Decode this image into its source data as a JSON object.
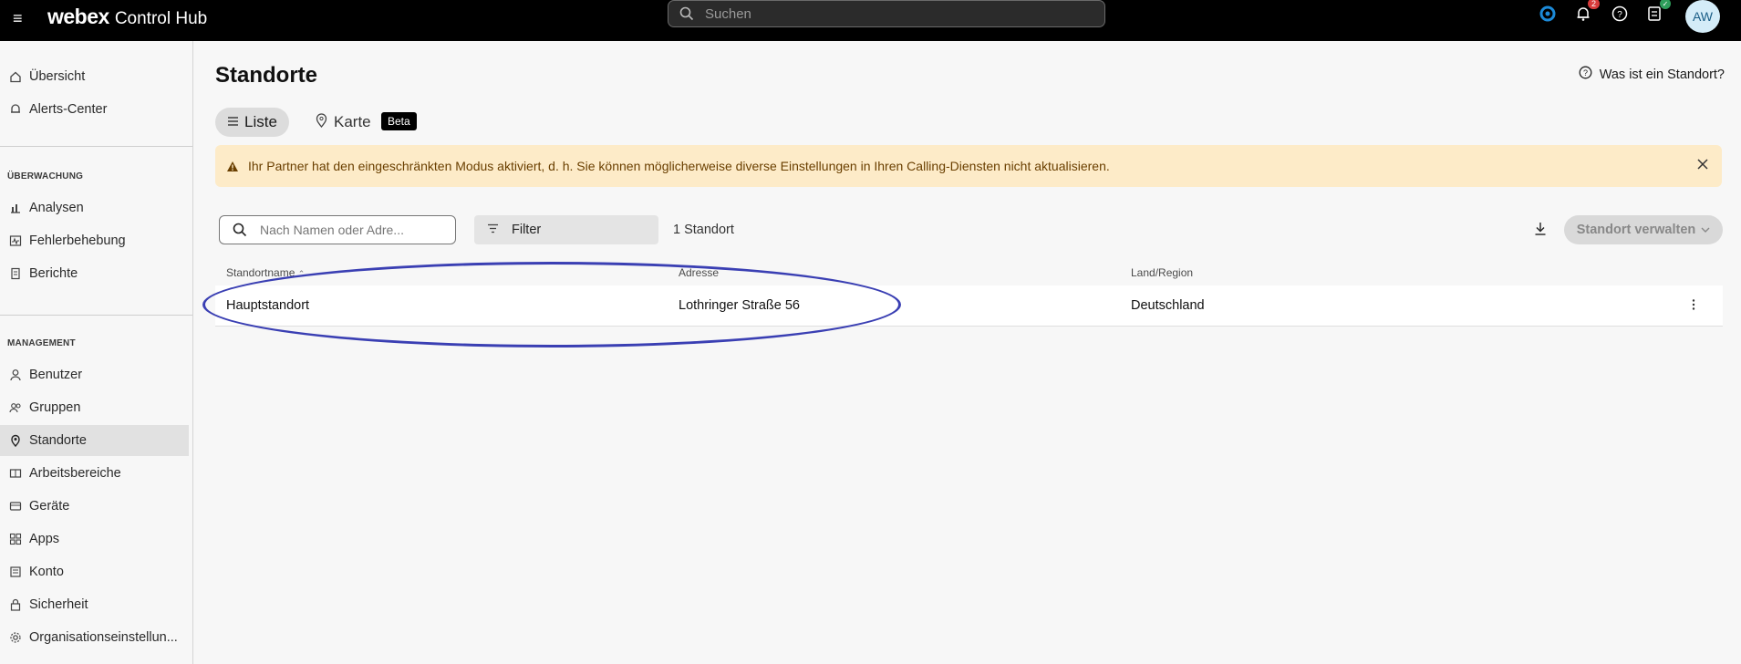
{
  "topbar": {
    "brand_main": "webex",
    "brand_app": "Control Hub",
    "search_placeholder": "Suchen",
    "notification_count": "2",
    "avatar_initials": "AW"
  },
  "sidebar": {
    "top_items": [
      {
        "label": "Übersicht",
        "icon": "home-icon"
      },
      {
        "label": "Alerts-Center",
        "icon": "bell-icon"
      }
    ],
    "section_monitoring": "ÜBERWACHUNG",
    "monitoring_items": [
      {
        "label": "Analysen",
        "icon": "chart-icon"
      },
      {
        "label": "Fehlerbehebung",
        "icon": "pulse-icon"
      },
      {
        "label": "Berichte",
        "icon": "report-icon"
      }
    ],
    "section_management": "MANAGEMENT",
    "management_items": [
      {
        "label": "Benutzer",
        "icon": "user-icon"
      },
      {
        "label": "Gruppen",
        "icon": "group-icon"
      },
      {
        "label": "Standorte",
        "icon": "location-icon",
        "active": true
      },
      {
        "label": "Arbeitsbereiche",
        "icon": "workspace-icon"
      },
      {
        "label": "Geräte",
        "icon": "device-icon"
      },
      {
        "label": "Apps",
        "icon": "apps-icon"
      },
      {
        "label": "Konto",
        "icon": "account-icon"
      },
      {
        "label": "Sicherheit",
        "icon": "lock-icon"
      },
      {
        "label": "Organisationseinstellun...",
        "icon": "gear-icon"
      }
    ]
  },
  "main": {
    "title": "Standorte",
    "help_link": "Was ist ein Standort?",
    "tabs": {
      "list": "Liste",
      "map": "Karte",
      "beta": "Beta"
    },
    "warning": "Ihr Partner hat den eingeschränkten Modus aktiviert, d. h. Sie können möglicherweise diverse Einstellungen in Ihren Calling-Diensten nicht aktualisieren.",
    "filter_placeholder": "Nach Namen oder Adre...",
    "filter_button": "Filter",
    "count": "1 Standort",
    "manage_button": "Standort verwalten",
    "table": {
      "columns": [
        "Standortname",
        "Adresse",
        "Land/Region"
      ],
      "rows": [
        {
          "name": "Hauptstandort",
          "address": "Lothringer Straße 56",
          "country": "Deutschland"
        }
      ]
    }
  },
  "colors": {
    "accent_highlight": "#3a3fb3",
    "warning_bg": "#fdebc8",
    "topbar_bg": "#000000"
  }
}
